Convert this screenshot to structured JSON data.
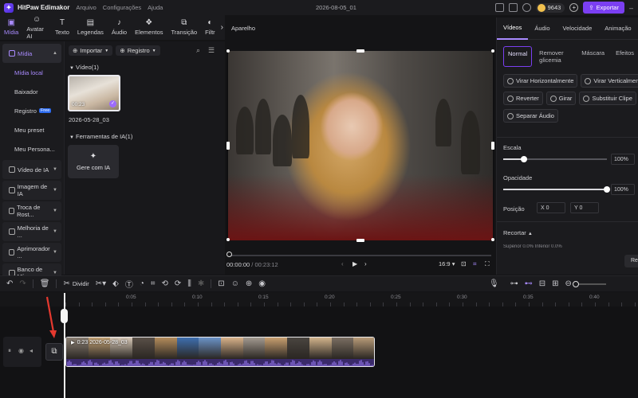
{
  "app": {
    "name": "HitPaw Edimakor",
    "menus": [
      "Arquivo",
      "Configurações",
      "Ajuda"
    ],
    "doc_title": "2026-08-05_01",
    "coins": "9643",
    "export_label": "Exportar"
  },
  "tooltabs": [
    {
      "label": "Mídia",
      "icon": "media-icon"
    },
    {
      "label": "Avatar AI",
      "icon": "avatar-icon"
    },
    {
      "label": "Texto",
      "icon": "text-icon"
    },
    {
      "label": "Legendas",
      "icon": "subtitles-icon"
    },
    {
      "label": "Áudio",
      "icon": "audio-icon"
    },
    {
      "label": "Elementos",
      "icon": "elements-icon"
    },
    {
      "label": "Transição",
      "icon": "transition-icon"
    },
    {
      "label": "Filtr",
      "icon": "filter-icon"
    }
  ],
  "sidebar": {
    "main_group": "Mídia",
    "items": [
      "Mídia local",
      "Baixador",
      "Registro",
      "Meu preset",
      "Meu Persona..."
    ],
    "free_badge": "Free",
    "groups": [
      "Vídeo de IA",
      "Imagem de IA",
      "Troca de Rost...",
      "Melhoria de ...",
      "Aprimorador ...",
      "Banco de Mí..."
    ]
  },
  "media": {
    "import_label": "Importar",
    "registry_label": "Registro",
    "video_section": "Vídeo(1)",
    "clip_duration": "00:23",
    "clip_name": "2026-05-28_03",
    "ai_section": "Ferramentas de IA(1)",
    "ai_card_label": "Gere com IA"
  },
  "preview": {
    "title": "Aparelho",
    "current_time": "00:00:00",
    "total_time": "00:23:12",
    "aspect": "16:9"
  },
  "props": {
    "tabs": [
      "Vídeos",
      "Áudio",
      "Velocidade",
      "Animação"
    ],
    "subtabs": [
      "Normal",
      "Remover glicemia",
      "Máscara",
      "Efeitos"
    ],
    "buttons_row1": [
      "Virar Horizontalmente",
      "Virar Verticalmente"
    ],
    "buttons_row2": [
      "Reverter",
      "Girar",
      "Substituir Clipe"
    ],
    "buttons_row3": [
      "Separar Áudio"
    ],
    "scale_label": "Escala",
    "scale_value": "100%",
    "scale_fraction": 0.2,
    "opacity_label": "Opacidade",
    "opacity_value": "100%",
    "opacity_fraction": 1.0,
    "position_label": "Posição",
    "pos_x": "X   0",
    "pos_y": "Y   0",
    "crop_label": "Recortar",
    "crop_subtext": "Superior 0.0%          Inferior 0.0%",
    "reset_label": "Re"
  },
  "timeline": {
    "divide_label": "Dividir",
    "ticks": [
      "0:05",
      "0:10",
      "0:15",
      "0:20",
      "0:25",
      "0:30",
      "0:35",
      "0:40"
    ],
    "clip_label": "0:23  2026-05-28_03"
  }
}
